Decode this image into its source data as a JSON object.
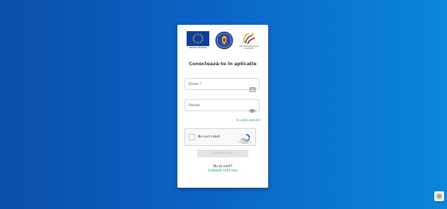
{
  "header": {
    "logos": {
      "eu_caption": "UNIUNEA EUROPEANĂ",
      "gov_logo": "romania-government-logo",
      "region_caption": "Instrumente Structurale 2014-2020"
    }
  },
  "form": {
    "title": "Conectează-te în aplicație",
    "email_label": "Email *",
    "password_label": "Parola",
    "forgot_password": "Ai uitat parola?",
    "recaptcha": {
      "label": "Nu sunt robot",
      "brand": "reCAPTCHA",
      "links": "Confidențialitate - Termeni"
    },
    "submit_label": "AUTENTIFICARE",
    "no_account": "Nu ai cont?",
    "create_account": "Creează cont nou"
  },
  "icons": {
    "email": "mail-icon",
    "password": "eye-toggle-icon",
    "settings": "gear-icon"
  },
  "colors": {
    "accent": "#1a9a8e",
    "background_start": "#0a4fa8",
    "background_end": "#0a86dd",
    "eu_blue": "#0f3e9d"
  }
}
